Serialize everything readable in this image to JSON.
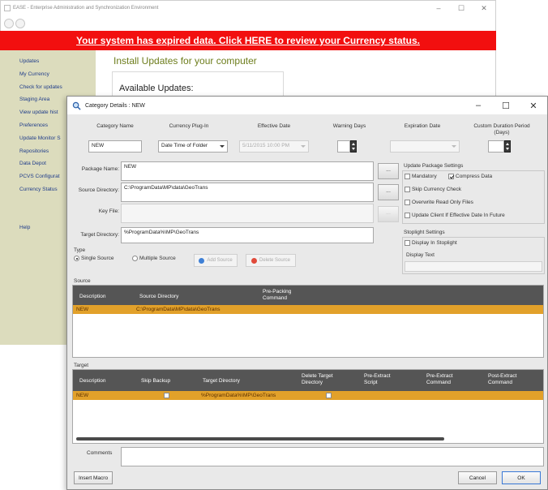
{
  "background_window": {
    "title": "EASE - Enterprise Administration and Synchronization Environment",
    "controls": [
      "–",
      "☐",
      "✕"
    ],
    "banner": "Your system has expired data.  Click HERE to review your Currency status.",
    "sidebar": [
      "Updates",
      "My Currency",
      "Check for updates",
      "Staging Area",
      "View update hist",
      "Preferences",
      "Update Monitor S",
      "Repositories",
      "Data Depot",
      "PCVS Configurat",
      "Currency Status",
      "",
      "",
      "Help"
    ],
    "heading": "Install Updates for your computer",
    "panel_title": "Available Updates:"
  },
  "dialog": {
    "title": "Category Details  :  NEW",
    "controls": [
      "–",
      "☐",
      "✕"
    ],
    "top_labels": {
      "category_name": "Category Name",
      "currency_plugin": "Currency Plug-In",
      "effective_date": "Effective Date",
      "warning_days": "Warning Days",
      "expiration_date": "Expiration Date",
      "custom_duration": "Custom Duration Period (Days)"
    },
    "top_values": {
      "category_name": "NEW",
      "currency_plugin": "Date Time of Folder",
      "effective_date": "5/11/2015 10:00 PM"
    },
    "fields": {
      "package_name_label": "Package Name:",
      "package_name": "NEW",
      "source_dir_label": "Source Directory:",
      "source_dir": "C:\\ProgramData\\MP\\data\\GeoTrans",
      "key_file_label": "Key File:",
      "key_file": "",
      "target_dir_label": "Target Directory:",
      "target_dir": "%ProgramData%\\MP\\GeoTrans",
      "browse_label": "..."
    },
    "type": {
      "label": "Type",
      "single": "Single Source",
      "multiple": "Multiple Source",
      "add_source": "Add Source",
      "delete_source": "Delete Source"
    },
    "update_settings": {
      "title": "Update Package Settings",
      "mandatory": "Mandatory",
      "compress_data": "Compress Data",
      "skip_currency": "Skip Currency Check",
      "overwrite_ro": "Overwrite Read Only Files",
      "update_client": "Update Client If Effective Date In Future"
    },
    "stoplight": {
      "title": "Stoplight Settings",
      "display": "Display In Stoplight",
      "display_text_label": "Display Text"
    },
    "source": {
      "label": "Source",
      "headers": [
        "Description",
        "Source Directory",
        "Pre-Packing Command"
      ],
      "rows": [
        {
          "description": "NEW",
          "directory": "C:\\ProgramData\\MP\\data\\GeoTrans",
          "command": ""
        }
      ]
    },
    "target": {
      "label": "Target",
      "headers": [
        "Description",
        "Skip Backup",
        "Target Directory",
        "Delete Target Directory",
        "Pre-Extract Script",
        "Pre-Extract Command",
        "Post-Extract Command"
      ],
      "rows": [
        {
          "description": "NEW",
          "directory": "%ProgramData%\\MP\\GeoTrans"
        }
      ]
    },
    "comments_label": "Comments",
    "insert_macro": "Insert Macro",
    "cancel": "Cancel",
    "ok": "OK"
  }
}
